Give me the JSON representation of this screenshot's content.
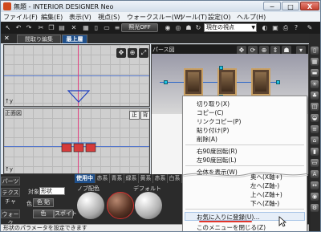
{
  "window": {
    "title": "無題 - INTERIOR DESIGNER Neo",
    "minimize": "−",
    "maximize": "□",
    "close": "X"
  },
  "menu": [
    "ファイル(F)",
    "編集(E)",
    "表示(V)",
    "視点(S)",
    "ウォークスルー(W)",
    "ツール(T)",
    "設定(O)",
    "ヘルプ(H)"
  ],
  "toolbar": {
    "light_toggle": "照光OFF",
    "viewpoint_select": "現在の視点"
  },
  "tabs": [
    "間取り編集",
    "最上層"
  ],
  "viewports": {
    "top_label": "平面図",
    "front_label": "正面図",
    "side_label": "側",
    "front_btn": "正",
    "back_btn": "背",
    "persp_label": "パース図"
  },
  "context_menu": {
    "cut": "切り取り(X)",
    "copy": "コピー(C)",
    "link_copy": "リンクコピー(P)",
    "paste": "貼り付け(P)",
    "delete": "削除(A)",
    "rotate_right": "右90度回転(R)",
    "rotate_left": "左90度回転(L)",
    "show_all": "全体を表示(W)",
    "move_back": "奥へ(X軸+)",
    "move_left": "左へ(Z軸-)",
    "move_up": "上へ(Z軸+)",
    "move_down": "下へ(Z軸-)",
    "add_favorite": "お気に入りに登録(U)...",
    "close_menu": "このメニューを閉じる(Z)"
  },
  "bottom": {
    "parts_tab": "パーツ",
    "texture_tab": "テクスチャ",
    "walk_tab": "ウォーク",
    "target_label": "対象:",
    "target_value": "形状",
    "color_label": "色",
    "color_paint": "色 貼",
    "eyedropper": "スポイト",
    "material_tabs": [
      "使用中",
      "赤系",
      "青系",
      "緑系",
      "黄系",
      "赤系",
      "白系"
    ],
    "material_swatch_label": "ノブ配色",
    "default_label": "デフォルト",
    "status": "形状のパラメータを設定できます"
  },
  "colors": {
    "accent_blue": "#1f4f8a",
    "annotation_red": "#e2352a",
    "selection_cyan": "#20c0e0"
  }
}
